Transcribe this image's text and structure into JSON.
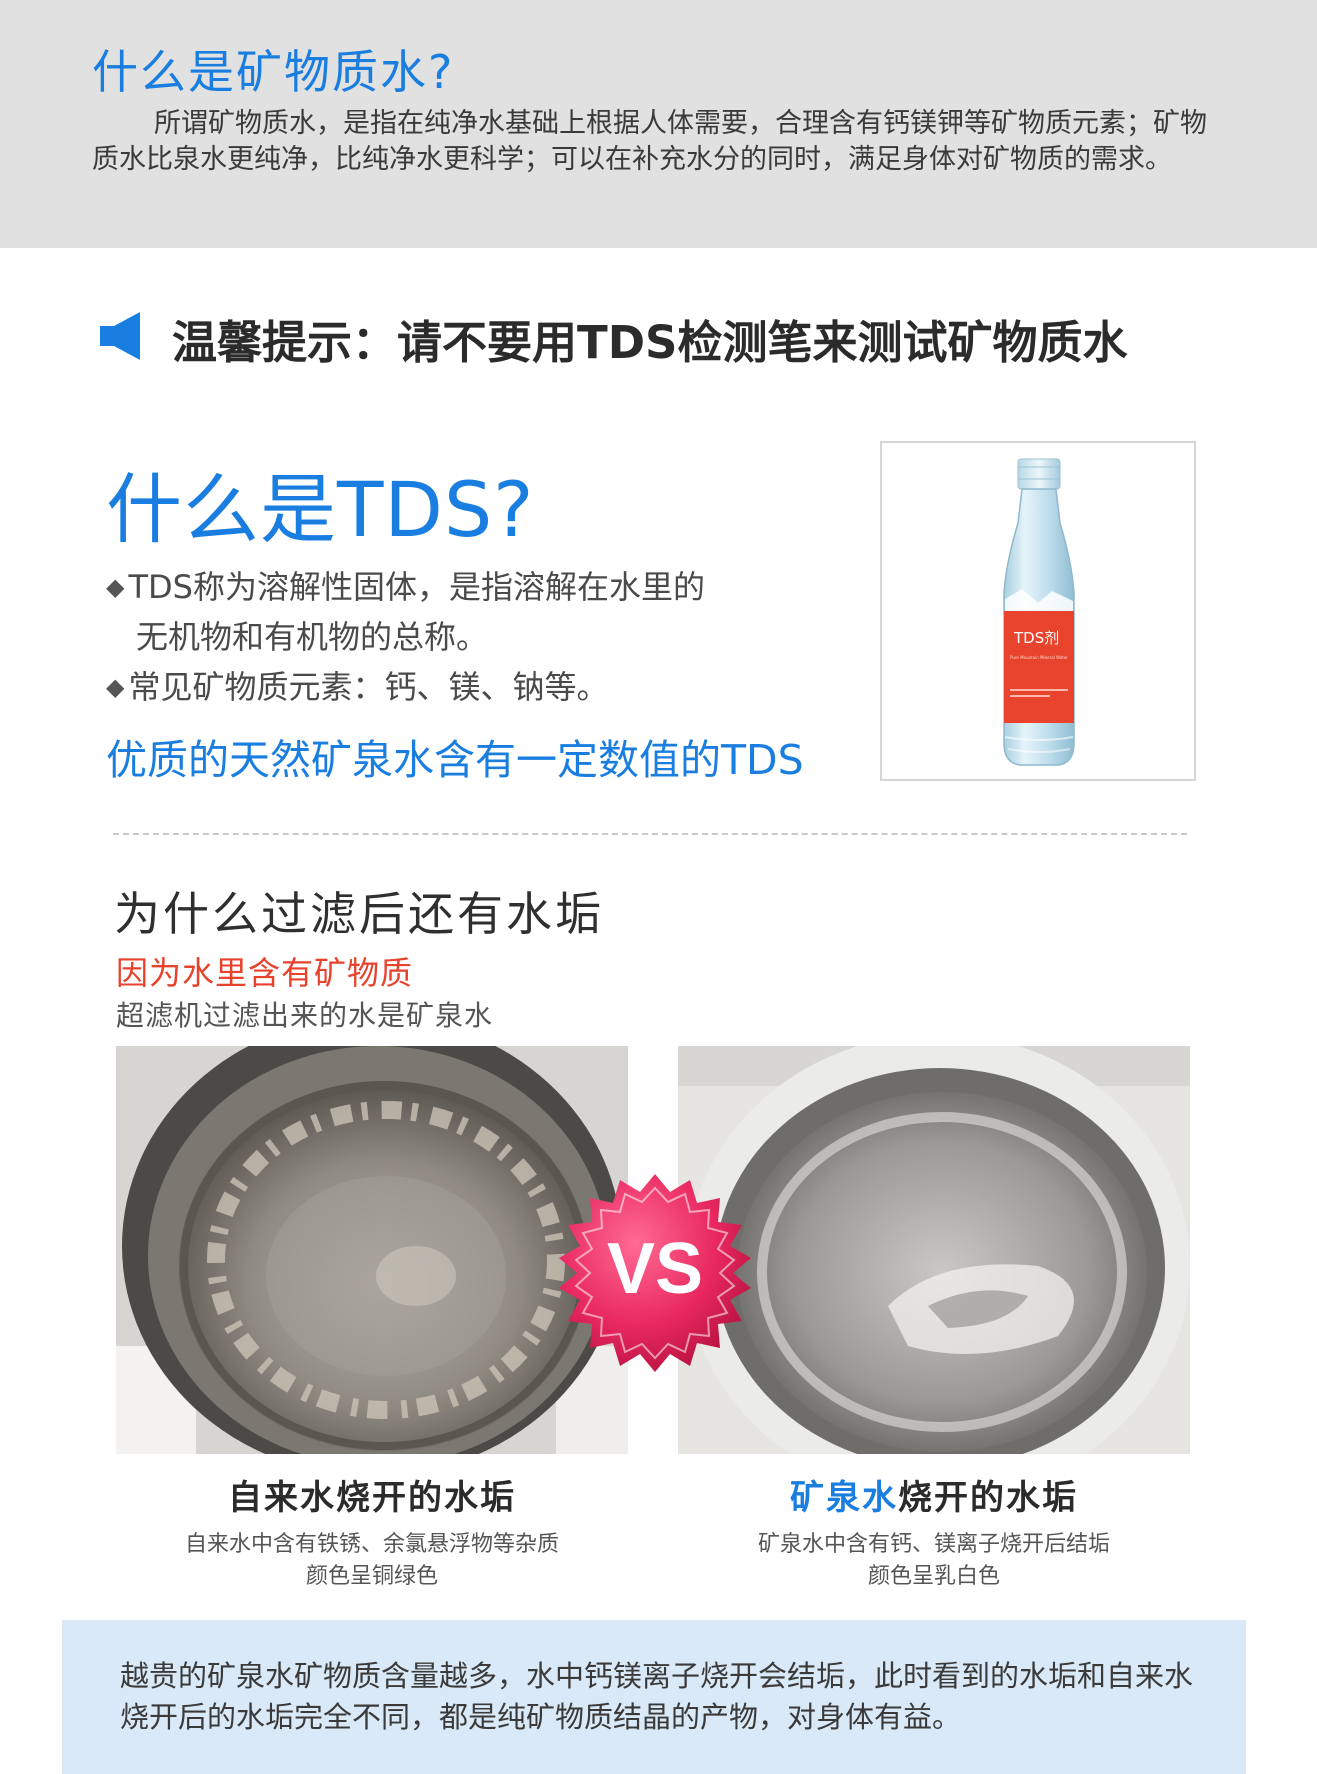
{
  "intro": {
    "title": "什么是矿物质水?",
    "body": "所谓矿物质水，是指在纯净水基础上根据人体需要，合理含有钙镁钾等矿物质元素；矿物质水比泉水更纯净，比纯净水更科学；可以在补充水分的同时，满足身体对矿物质的需求。"
  },
  "tip": {
    "icon": "speaker-icon",
    "text": "温馨提示：请不要用TDS检测笔来测试矿物质水"
  },
  "tds": {
    "title": "什么是TDS?",
    "bullet_symbol": "◆",
    "item1_line1": "TDS称为溶解性固体，是指溶解在水里的",
    "item1_line2": "无机物和有机物的总称。",
    "item2": "常见矿物质元素：钙、镁、钠等。",
    "highlight": "优质的天然矿泉水含有一定数值的TDS",
    "bottle_label": "TDS剂",
    "bottle_label_small": "Pure Mountain Mineral Water"
  },
  "scale": {
    "title": "为什么过滤后还有水垢",
    "reason": "因为水里含有矿物质",
    "note": "超滤机过滤出来的水是矿泉水",
    "vs": "VS",
    "left": {
      "title": "自来水烧开的水垢",
      "sub1": "自来水中含有铁锈、余氯悬浮物等杂质",
      "sub2": "颜色呈铜绿色"
    },
    "right": {
      "title_highlight": "矿泉水",
      "title_rest": "烧开的水垢",
      "sub1": "矿泉水中含有钙、镁离子烧开后结垢",
      "sub2": "颜色呈乳白色"
    }
  },
  "note": {
    "text": "越贵的矿泉水矿物质含量越多，水中钙镁离子烧开会结垢，此时看到的水垢和自来水烧开后的水垢完全不同，都是纯矿物质结晶的产物，对身体有益。"
  },
  "colors": {
    "accent_blue": "#1a7ee0",
    "accent_red": "#e8412c",
    "intro_bg": "#e1e1e1",
    "note_bg": "#d9e9f7",
    "vs_pink": "#e8285f"
  }
}
